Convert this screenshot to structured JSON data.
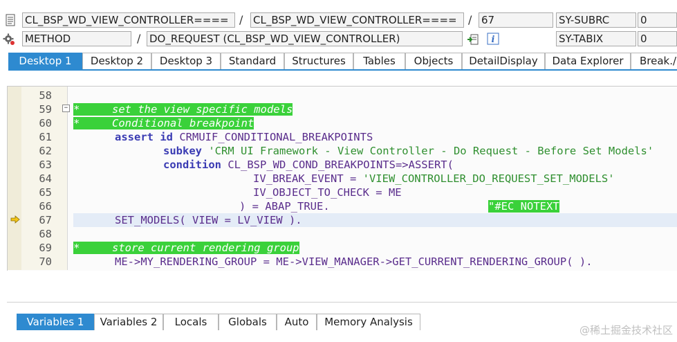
{
  "header": {
    "row1": {
      "program": "CL_BSP_WD_VIEW_CONTROLLER====",
      "include": "CL_BSP_WD_VIEW_CONTROLLER====",
      "line": "67",
      "sysfield": "SY-SUBRC",
      "sysvalue": "0"
    },
    "row2": {
      "event_type": "METHOD",
      "event_name": "DO_REQUEST (CL_BSP_WD_VIEW_CONTROLLER)",
      "sysfield": "SY-TABIX",
      "sysvalue": "0"
    },
    "separator": "/"
  },
  "top_tabs": [
    "Desktop 1",
    "Desktop 2",
    "Desktop 3",
    "Standard",
    "Structures",
    "Tables",
    "Objects",
    "DetailDisplay",
    "Data Explorer",
    "Break./"
  ],
  "editor": {
    "line_numbers": [
      "58",
      "59",
      "60",
      "61",
      "62",
      "63",
      "64",
      "65",
      "66",
      "67",
      "68",
      "69",
      "70"
    ],
    "lines": {
      "l59": "*     set the view specific models",
      "l60": "*     Conditional breakpoint",
      "l61_kw": "assert id",
      "l61_rest": " CRMUIF_CONDITIONAL_BREAKPOINTS",
      "l62_kw": "subkey",
      "l62_str": " 'CRM UI Framework - View Controller - Do Request - Before Set Models'",
      "l63_kw": "condition",
      "l63_rest": " CL_BSP_WD_COND_BREAKPOINTS=>ASSERT(",
      "l64_a": "IV_BREAK_EVENT = ",
      "l64_str": "'VIEW_CONTROLLER_DO_REQUEST_SET_MODELS'",
      "l65": "IV_OBJECT_TO_CHECK = ME",
      "l66": ") = ABAP_TRUE.",
      "l66_cmt": "\"#EC NOTEXT",
      "l67": "SET_MODELS( VIEW = LV_VIEW ).",
      "l69": "*     store current rendering group",
      "l70": "ME->MY_RENDERING_GROUP = ME->VIEW_MANAGER->GET_CURRENT_RENDERING_GROUP( )."
    },
    "fold_marker": "−"
  },
  "bottom_tabs": [
    "Variables 1",
    "Variables 2",
    "Locals",
    "Globals",
    "Auto",
    "Memory Analysis"
  ],
  "watermark": "@稀土掘金技术社区",
  "colors": {
    "accent": "#2e8ad0",
    "comment_bg": "#3ad13a",
    "string": "#2f8f2f",
    "keyword": "#3a3bb3",
    "current_line": "#e4ecf7"
  }
}
